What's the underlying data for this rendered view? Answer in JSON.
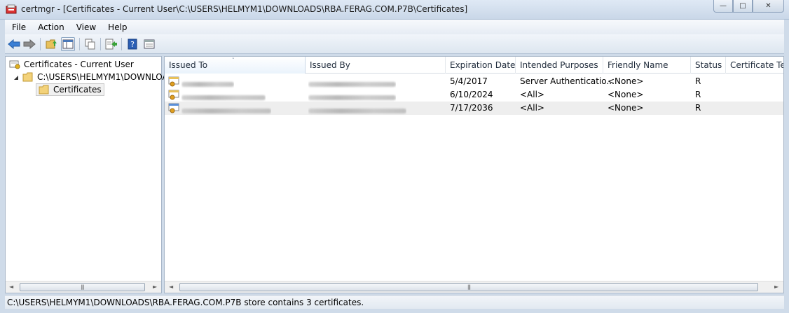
{
  "window": {
    "title": "certmgr - [Certificates - Current User\\C:\\USERS\\HELMYM1\\DOWNLOADS\\RBA.FERAG.COM.P7B\\Certificates]",
    "minimize_glyph": "—",
    "maximize_glyph": "□",
    "close_glyph": "✕"
  },
  "menu": {
    "items": [
      "File",
      "Action",
      "View",
      "Help"
    ]
  },
  "toolbar": {
    "icons": [
      "back-arrow-icon",
      "forward-arrow-icon",
      "up-folder-icon",
      "show-hide-tree-icon",
      "copy-icon",
      "export-list-icon",
      "help-icon",
      "properties-icon"
    ]
  },
  "tree": {
    "root": "Certificates - Current User",
    "store": "C:\\USERS\\HELMYM1\\DOWNLOA",
    "selected": "Certificates"
  },
  "list": {
    "columns": [
      "Issued To",
      "Issued By",
      "Expiration Date",
      "Intended Purposes",
      "Friendly Name",
      "Status",
      "Certificate Te..."
    ],
    "sort_arrow": "˄",
    "rows": [
      {
        "expiration": "5/4/2017",
        "purposes": "Server Authenticatio...",
        "friendly": "<None>",
        "status": "R"
      },
      {
        "expiration": "6/10/2024",
        "purposes": "<All>",
        "friendly": "<None>",
        "status": "R"
      },
      {
        "expiration": "7/17/2036",
        "purposes": "<All>",
        "friendly": "<None>",
        "status": "R"
      }
    ]
  },
  "scrollbar": {
    "left_arrow": "◄",
    "right_arrow": "►",
    "grip": "|||"
  },
  "statusbar": {
    "text": "C:\\USERS\\HELMYM1\\DOWNLOADS\\RBA.FERAG.COM.P7B store contains 3 certificates."
  },
  "colors": {
    "frame": "#cfdbe9",
    "alt_row": "#eeeeee",
    "sorted_header": "#eaf3fc"
  }
}
